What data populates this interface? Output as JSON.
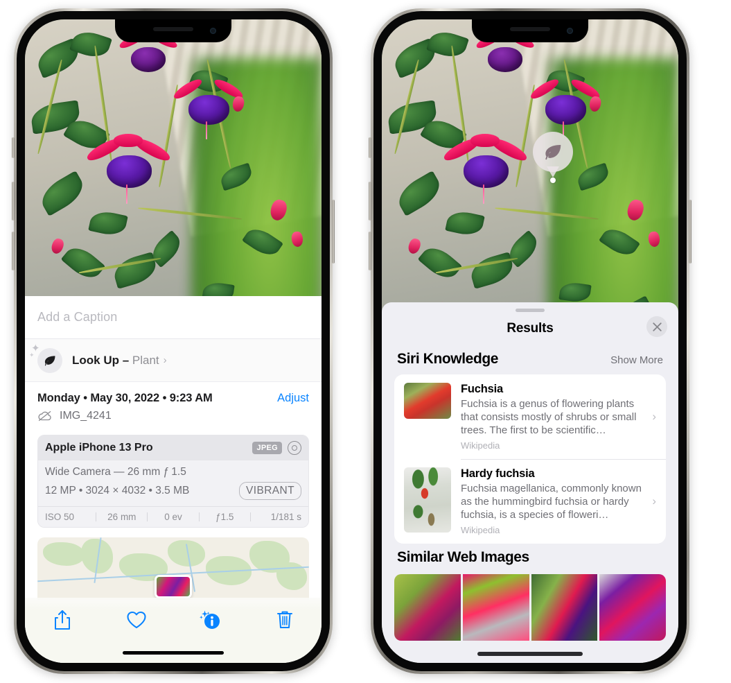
{
  "left_phone": {
    "caption": {
      "value": "",
      "placeholder": "Add a Caption"
    },
    "lookup": {
      "icon": "leaf-icon",
      "label": "Look Up – ",
      "subject": "Plant",
      "chevron": "›"
    },
    "meta": {
      "date": "Monday • May 30, 2022 • 9:23 AM",
      "adjust_label": "Adjust",
      "cloud_icon": "cloud-slash-icon",
      "filename": "IMG_4241"
    },
    "camera_card": {
      "device": "Apple iPhone 13 Pro",
      "format_badge": "JPEG",
      "raw_icon": "aperture-icon",
      "lens_line": "Wide Camera — 26 mm ƒ 1.5",
      "specs_line": "12 MP • 3024 × 4032 • 3.5 MB",
      "vibrant_badge": "VIBRANT",
      "exif": [
        "ISO 50",
        "26 mm",
        "0 ev",
        "ƒ1.5",
        "1/181 s"
      ]
    },
    "toolbar": [
      {
        "name": "share-icon",
        "label": "Share"
      },
      {
        "name": "heart-icon",
        "label": "Favorite"
      },
      {
        "name": "info-icon",
        "label": "Info"
      },
      {
        "name": "trash-icon",
        "label": "Delete"
      }
    ],
    "accent_color": "#0a84ff"
  },
  "right_phone": {
    "pin": {
      "icon": "leaf-icon"
    },
    "sheet": {
      "title": "Results",
      "close_icon": "close-icon"
    },
    "siri_knowledge": {
      "heading": "Siri Knowledge",
      "action": "Show More",
      "items": [
        {
          "title": "Fuchsia",
          "description": "Fuchsia is a genus of flowering plants that consists mostly of shrubs or small trees. The first to be scientific…",
          "source": "Wikipedia",
          "chevron": "›"
        },
        {
          "title": "Hardy fuchsia",
          "description": "Fuchsia magellanica, commonly known as the hummingbird fuchsia or hardy fuchsia, is a species of floweri…",
          "source": "Wikipedia",
          "chevron": "›"
        }
      ]
    },
    "similar_web_images": {
      "heading": "Similar Web Images",
      "thumbnails": [
        "fuchsia-web-1",
        "fuchsia-web-2",
        "fuchsia-web-3",
        "fuchsia-web-4"
      ]
    },
    "sheet_bg_color": "#EFEFF4"
  }
}
